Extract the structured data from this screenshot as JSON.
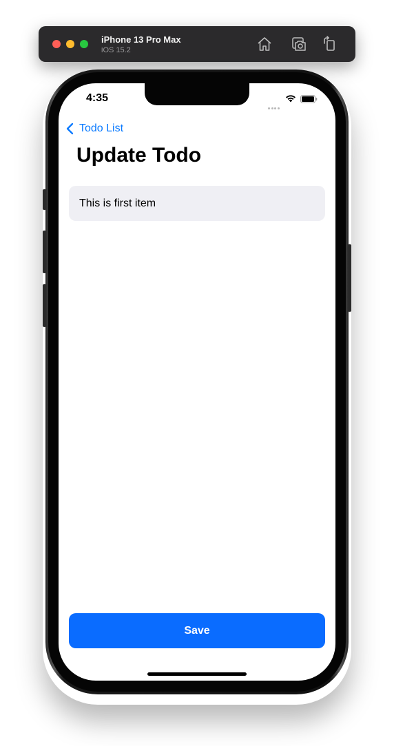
{
  "simulator": {
    "device_name": "iPhone 13 Pro Max",
    "os_version": "iOS 15.2"
  },
  "status_bar": {
    "time": "4:35"
  },
  "nav": {
    "back_label": "Todo List",
    "title": "Update Todo"
  },
  "form": {
    "todo_value": "This is first item"
  },
  "actions": {
    "save_label": "Save"
  },
  "colors": {
    "accent": "#0a7aff",
    "save_button": "#0a6cff",
    "field_background": "#efeff4"
  },
  "icons": [
    "home-icon",
    "screenshot-icon",
    "rotate-icon",
    "chevron-left-icon",
    "wifi-icon",
    "battery-icon"
  ]
}
